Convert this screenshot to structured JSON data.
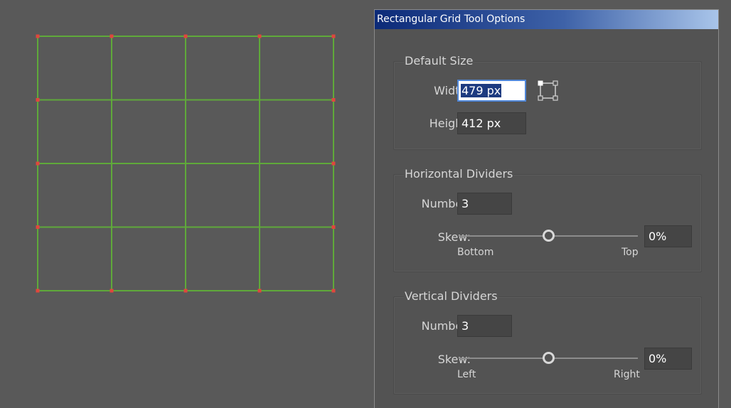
{
  "canvas": {
    "grid": {
      "columns": 4,
      "rows": 4,
      "line_color": "#5fa93a",
      "anchor_color": "#e0463d"
    }
  },
  "dialog": {
    "title": "Rectangular Grid Tool Options",
    "default_size": {
      "title": "Default Size",
      "width_label": "Width:",
      "width_value": "479 px",
      "height_label": "Height:",
      "height_value": "412 px",
      "origin_icon": "reference-point-icon"
    },
    "horizontal_dividers": {
      "title": "Horizontal Dividers",
      "number_label": "Number:",
      "number_value": "3",
      "skew_label": "Skew:",
      "skew_value": "0%",
      "skew_level": 0.5,
      "skew_min_label": "Bottom",
      "skew_max_label": "Top"
    },
    "vertical_dividers": {
      "title": "Vertical Dividers",
      "number_label": "Number:",
      "number_value": "3",
      "skew_label": "Skew:",
      "skew_value": "0%",
      "skew_level": 0.5,
      "skew_min_label": "Left",
      "skew_max_label": "Right"
    }
  }
}
